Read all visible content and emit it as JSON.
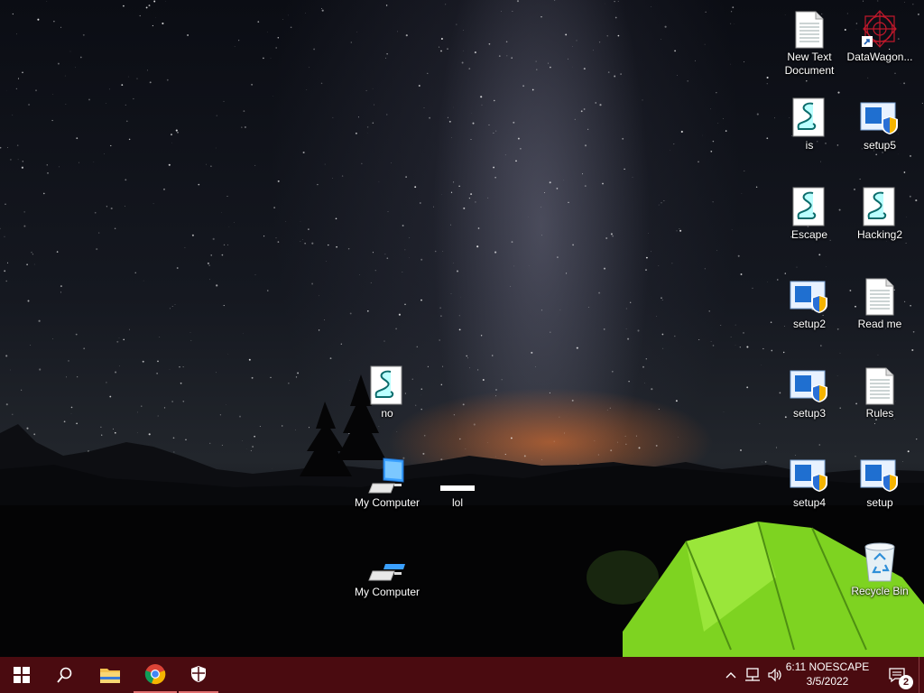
{
  "desktop": {
    "icons": [
      {
        "label": "New Text Document",
        "type": "text-file"
      },
      {
        "label": "DataWagon...",
        "type": "shortcut"
      },
      {
        "label": "is",
        "type": "script"
      },
      {
        "label": "setup5",
        "type": "installer"
      },
      {
        "label": "Escape",
        "type": "script"
      },
      {
        "label": "Hacking2",
        "type": "script"
      },
      {
        "label": "setup2",
        "type": "installer"
      },
      {
        "label": "Read me",
        "type": "text-file"
      },
      {
        "label": "setup3",
        "type": "installer"
      },
      {
        "label": "Rules",
        "type": "text-file"
      },
      {
        "label": "setup4",
        "type": "installer"
      },
      {
        "label": "setup",
        "type": "installer"
      },
      {
        "label": "Recycle Bin",
        "type": "recycle-bin"
      },
      {
        "label": "no",
        "type": "script"
      },
      {
        "label": "My Computer",
        "type": "computer"
      },
      {
        "label": "lol",
        "type": "blank"
      },
      {
        "label": "My Computer",
        "type": "computer-small"
      }
    ]
  },
  "taskbar": {
    "start_icon": "windows-logo-icon",
    "search_icon": "search-icon",
    "pinned": [
      {
        "name": "file-explorer-icon",
        "active": false
      },
      {
        "name": "chrome-icon",
        "active": true
      },
      {
        "name": "shield-icon",
        "active": true
      }
    ],
    "clock": {
      "time": "6:11 NOESCAPE",
      "date": "3/5/2022"
    },
    "notification_count": "2",
    "colors": {
      "taskbar": "#4a0b10",
      "accent": "#e07070"
    }
  }
}
